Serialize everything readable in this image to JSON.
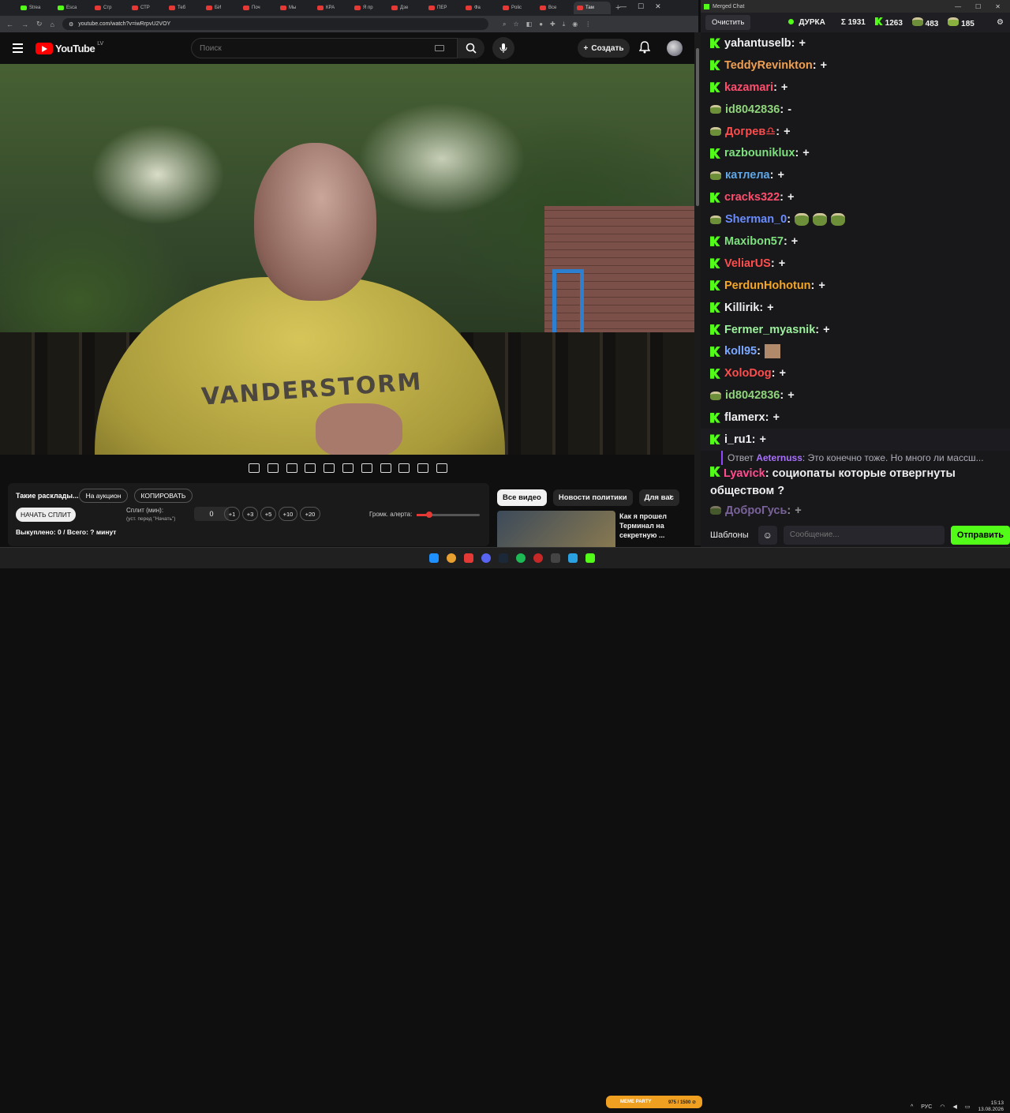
{
  "browser": {
    "tabs": [
      "Strea",
      "Esca",
      "Стр",
      "СТР",
      "Теб",
      "БИ",
      "Поч",
      "Мы",
      "КРА",
      "Я пр",
      "Дзе",
      "ПЕР",
      "Фа",
      "Polic",
      "Все",
      "Там"
    ],
    "url": "youtube.com/watch?v=iwRrpvU2VOY"
  },
  "youtube": {
    "logo": "YouTube",
    "region": "LV",
    "search_placeholder": "Поиск",
    "create_label": "Создать"
  },
  "panel": {
    "title": "Такие расклады...",
    "auction_btn": "На аукцион",
    "copy_btn": "КОПИРОВАТЬ",
    "start_split_btn": "НАЧАТЬ СПЛИТ",
    "split_label": "Сплит (мин):",
    "split_hint": "(уст. перед \"Начать\")",
    "split_value": "0",
    "increments": [
      "+1",
      "+3",
      "+5",
      "+10",
      "+20"
    ],
    "bought": "Выкуплено: 0 / Всего: ? минут",
    "alert_volume_label": "Громк. алерта:",
    "alert_volume": 0.2
  },
  "chips": [
    "Все видео",
    "Новости политики",
    "Для вас"
  ],
  "recommend": {
    "title": "Как я прошел Терминал на секретную ..."
  },
  "shirt_text": "VANDERSTORM",
  "chat": {
    "window_title": "Merged Chat",
    "clear_btn": "Очистить",
    "channel": "ДУРКА",
    "total": "Σ 1931",
    "kick_count": "1263",
    "vk_count": "483",
    "other_count": "185",
    "messages": [
      {
        "user": "yahantuselb",
        "color": "#efeff1",
        "src": "kick",
        "text": "+"
      },
      {
        "user": "TeddyRevinkton",
        "color": "#f0a050",
        "src": "kick",
        "text": "+"
      },
      {
        "user": "kazamari",
        "color": "#ff4d6d",
        "src": "kick",
        "text": "+"
      },
      {
        "user": "id8042836",
        "color": "#8fd47a",
        "src": "vk",
        "text": "-"
      },
      {
        "user": "Догрев♎",
        "color": "#ff4d4d",
        "src": "vk",
        "text": "+"
      },
      {
        "user": "razbouniklux",
        "color": "#7ee07e",
        "src": "kick",
        "text": "+"
      },
      {
        "user": "катлела",
        "color": "#5fa8e8",
        "src": "vk",
        "text": "+"
      },
      {
        "user": "cracks322",
        "color": "#ff4d6d",
        "src": "kick",
        "text": "+"
      },
      {
        "user": "Sherman_0",
        "color": "#6a8cff",
        "src": "vk",
        "text": ""
      },
      {
        "user": "Maxibon57",
        "color": "#7ee07e",
        "src": "kick",
        "text": "+"
      },
      {
        "user": "VeliarUS",
        "color": "#ff4d4d",
        "src": "kick",
        "text": "+"
      },
      {
        "user": "PerdunHohotun",
        "color": "#f5a623",
        "src": "kick",
        "text": "+"
      },
      {
        "user": "Killirik",
        "color": "#efeff1",
        "src": "kick",
        "text": "+"
      },
      {
        "user": "Fermer_myasnik",
        "color": "#9cf29c",
        "src": "kick",
        "text": "+"
      },
      {
        "user": "koll95",
        "color": "#7aa7ff",
        "src": "kick",
        "text": ""
      },
      {
        "user": "XoloDog",
        "color": "#ff4d4d",
        "src": "kick",
        "text": "+"
      },
      {
        "user": "id8042836",
        "color": "#8fd47a",
        "src": "vk",
        "text": "+"
      },
      {
        "user": "flamerx",
        "color": "#efeff1",
        "src": "kick",
        "text": "+"
      },
      {
        "user": "i_ru1",
        "color": "#efeff1",
        "src": "kick",
        "text": "+"
      }
    ],
    "reply": {
      "prefix": "Ответ",
      "user": "Aeternuss",
      "text": ": Это конечно тоже. Но много ли массш..."
    },
    "reply_msg": {
      "user": "Lyavick",
      "text": "социопаты которые отвергнуты обществом ?"
    },
    "last_msg": {
      "user": "ДоброГусь",
      "text": "+"
    },
    "templates_btn": "Шаблоны",
    "input_placeholder": "Сообщение...",
    "send_btn": "Отправить"
  },
  "taskbar": {
    "lang": "РУС",
    "time": "15:13",
    "date": "13.08.2026",
    "meme_party": "MEME PARTY",
    "meme_counter": "975 / 1500 ⊘"
  }
}
